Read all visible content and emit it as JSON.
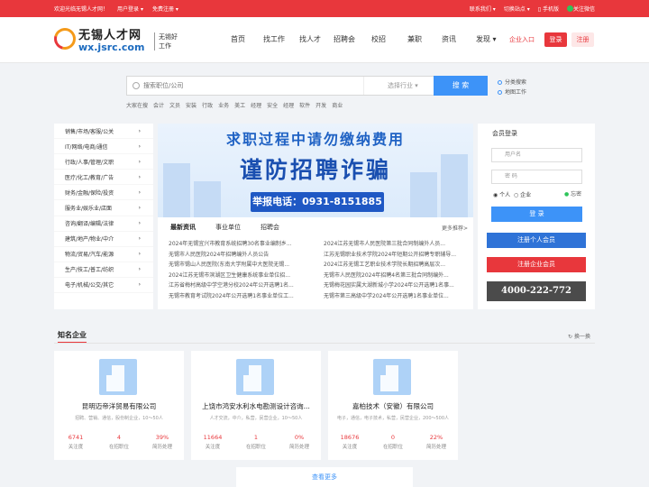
{
  "topbar": {
    "welcome": "欢迎光临无锡人才网！",
    "user_login": "用户登录",
    "free_register": "免费注册",
    "contact": "联系我们",
    "switch_site": "切换站点",
    "mobile": "手机版",
    "wechat": "关注微信"
  },
  "logo": {
    "cn": "无锡人才网",
    "en": "wx.jsrc.com",
    "slogan": "无锡好工作"
  },
  "nav": [
    "首页",
    "找工作",
    "找人才",
    "招聘会",
    "校招",
    "兼职",
    "资讯",
    "发现"
  ],
  "header": {
    "enterprise": "企业入口",
    "login": "登录",
    "register": "注册"
  },
  "search": {
    "placeholder": "搜索职位/公司",
    "industry": "选择行业",
    "button": "搜 索"
  },
  "side_links": [
    "分类搜索",
    "地图工作"
  ],
  "hotwords": [
    "大家在搜",
    "会计",
    "文员",
    "安装",
    "行政",
    "业务",
    "美工",
    "经理",
    "安全",
    "经理",
    "软件",
    "开发",
    "商业"
  ],
  "categories": [
    "销售/市场/客服/公关",
    "IT/网络/电商/通信",
    "行政/人事/管理/文职",
    "医疗/化工/教育/广告",
    "财务/金融/保险/投资",
    "服务业/娱乐业/店面",
    "咨询/翻译/编辑/法律",
    "建筑/地产/物业/中介",
    "物流/贸易/汽车/能源",
    "生产/技工/普工/纺织",
    "电子/机械/公交/其它"
  ],
  "banner": {
    "line1": "求职过程中请勿缴纳费用",
    "line2": "谨防招聘诈骗",
    "hotline": "举报电话：0931-8151885"
  },
  "news": {
    "tabs": [
      "最新资讯",
      "事业单位",
      "招聘会"
    ],
    "more": "更多推荐>",
    "left": [
      "2024年无锡宜兴市教育系统招聘30名事业编制乡...",
      "无锡市人民医院2024年招聘编外人员公告",
      "无锡市锡山人民医院(东南大学附属中大医院无锡...",
      "2024江苏无锡市滨湖区卫生健康系统事业单位招...",
      "江苏省梅村高级中学空港分校2024年公开选聘1名...",
      "无锡市教育考试院2024年公开选聘1名事业单位工..."
    ],
    "right": [
      "2024江苏无锡市人民医院第三批合同制编外人员...",
      "江苏无锡职业技术学院2024年短期公开招聘专职辅导...",
      "2024江苏无锡工艺职业技术学院长期招聘高层次...",
      "无锡市人民医院2024年招聘4名第三批合同制编外...",
      "无锡梅花园实属大湖新城小学2024年公开选聘1名事...",
      "无锡市第三高级中学2024年公开选聘1名事业单位..."
    ]
  },
  "login": {
    "title": "会员登录",
    "username": "用户名",
    "password": "密 码",
    "personal": "个人",
    "enterprise": "企业",
    "forgot": "忘密",
    "button": "登 录",
    "reg_personal": "注册个人会员",
    "reg_enterprise": "注册企业会员",
    "phone": "4000-222-772"
  },
  "section": {
    "title": "知名企业",
    "refresh": "换一换",
    "more": "查看更多"
  },
  "companies": [
    {
      "name": "昆明迈帝洋贸易有限公司",
      "meta": "招聘、营销、通信，股份制企业，10～50人",
      "s1": "6741",
      "s2": "4",
      "s3": "39%"
    },
    {
      "name": "上饶市鸿安水利水电勘测设计咨询...",
      "meta": "人才交流，中介，私营，民营企业，10～50人",
      "s1": "11664",
      "s2": "1",
      "s3": "0%"
    },
    {
      "name": "嘉柏技术（安徽）有限公司",
      "meta": "电子，通信，电子技术，私营，民营企业，200～500人",
      "s1": "18676",
      "s2": "0",
      "s3": "22%"
    }
  ],
  "stat_labels": [
    "关注度",
    "在招职位",
    "简历处理"
  ],
  "colors": {
    "brand_red": "#e8373c",
    "accent_blue": "#3d93f8",
    "orange": "#f49a1a"
  }
}
